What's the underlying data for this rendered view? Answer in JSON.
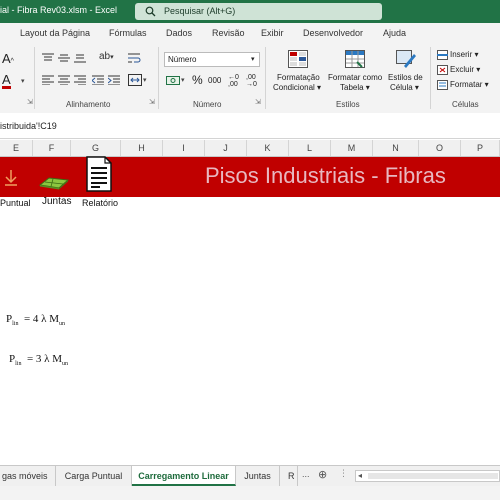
{
  "title_bar": {
    "title": "ial - Fibra Rev03.xlsm  -  Excel",
    "search_placeholder": "Pesquisar (Alt+G)"
  },
  "menu": {
    "tabs": [
      "Layout da Página",
      "Fórmulas",
      "Dados",
      "Revisão",
      "Exibir",
      "Desenvolvedor",
      "Ajuda"
    ]
  },
  "ribbon": {
    "number_format": "Número",
    "percent_symbol": "%",
    "thousands_symbol": "000",
    "cond_format_1": "Formatação",
    "cond_format_2": "Condicional",
    "format_table_1": "Formatar como",
    "format_table_2": "Tabela",
    "cell_styles_1": "Estilos de",
    "cell_styles_2": "Célula",
    "insert": "Inserir",
    "delete": "Excluir",
    "format": "Formatar",
    "groups": {
      "alignment": "Alinhamento",
      "number": "Número",
      "styles": "Estilos",
      "cells": "Células"
    }
  },
  "formula_bar": {
    "text": "istribuida'!C19"
  },
  "columns": [
    "E",
    "F",
    "G",
    "H",
    "I",
    "J",
    "K",
    "L",
    "M",
    "N",
    "O",
    "P"
  ],
  "banner": {
    "title": "Pisos Industriais - Fibras",
    "label_pontual": "Puntual",
    "label_juntas": "Juntas",
    "label_relatorio": "Relatório"
  },
  "formulas": {
    "f1_lhs": "P",
    "f1_lhs_sub": "lin",
    "f1_rhs": "= 4 λ M",
    "f1_rhs_sub": "un",
    "f2_lhs": "P",
    "f2_lhs_sub": "lin",
    "f2_rhs": "= 3 λ M",
    "f2_rhs_sub": "un"
  },
  "sheet_tabs": {
    "tabs": [
      "gas móveis",
      "Carga Puntual",
      "Carregamento Linear",
      "Juntas",
      "R"
    ],
    "active": "Carregamento Linear",
    "more": "...",
    "add": "⊕"
  },
  "colors": {
    "excel_green": "#217346",
    "banner_red": "#c00000",
    "banner_text": "#e8b8c0"
  }
}
